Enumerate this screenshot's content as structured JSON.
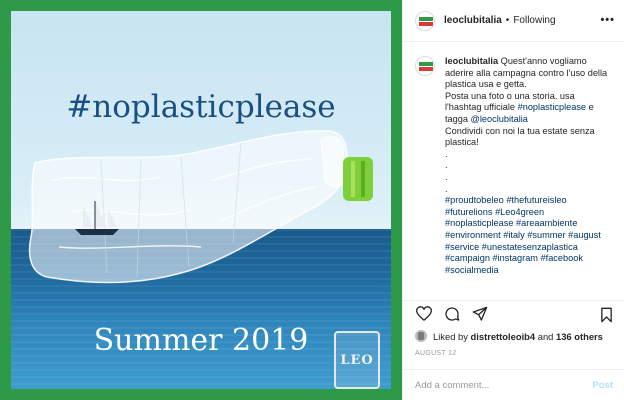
{
  "post": {
    "headline": "#noplasticplease",
    "footer_text": "Summer 2019",
    "badge_text": "LEO",
    "colors": {
      "frame": "#2e9a49",
      "headline": "#1b4f80",
      "link": "#003569",
      "post_disabled": "#b2dffc"
    }
  },
  "header": {
    "username": "leoclubitalia",
    "separator": "•",
    "follow_status": "Following",
    "more_icon": "more-horizontal-icon"
  },
  "caption": {
    "username": "leoclubitalia",
    "lines": [
      "Quest'anno vogliamo aderire alla campagna contro l'uso della plastica usa e getta.",
      "Posta una foto o una storia. usa l'hashtag ufficiale ",
      "#noplasticplease",
      " e tagga ",
      "@leoclubitalia",
      "Condividi con noi la tua estate senza plastica!"
    ],
    "dots": [
      ".",
      ".",
      ".",
      "."
    ],
    "hashtags": [
      "#proudtobeleo",
      "#thefutureisleo",
      "#futurelions",
      "#Leo4green",
      "#noplasticplease",
      "#areaambiente",
      "#environment",
      "#italy",
      "#summer",
      "#august",
      "#service",
      "#unestatesenzaplastica",
      "#campaign",
      "#instagram",
      "#facebook",
      "#socialmedia"
    ]
  },
  "actions": {
    "icons": [
      "heart-icon",
      "comment-icon",
      "share-icon",
      "bookmark-icon"
    ]
  },
  "likes": {
    "prefix": "Liked by ",
    "user": "distrettoleoib4",
    "middle": " and ",
    "others": "136 others"
  },
  "date": "AUGUST 12",
  "comment": {
    "placeholder": "Add a comment...",
    "post_label": "Post"
  }
}
